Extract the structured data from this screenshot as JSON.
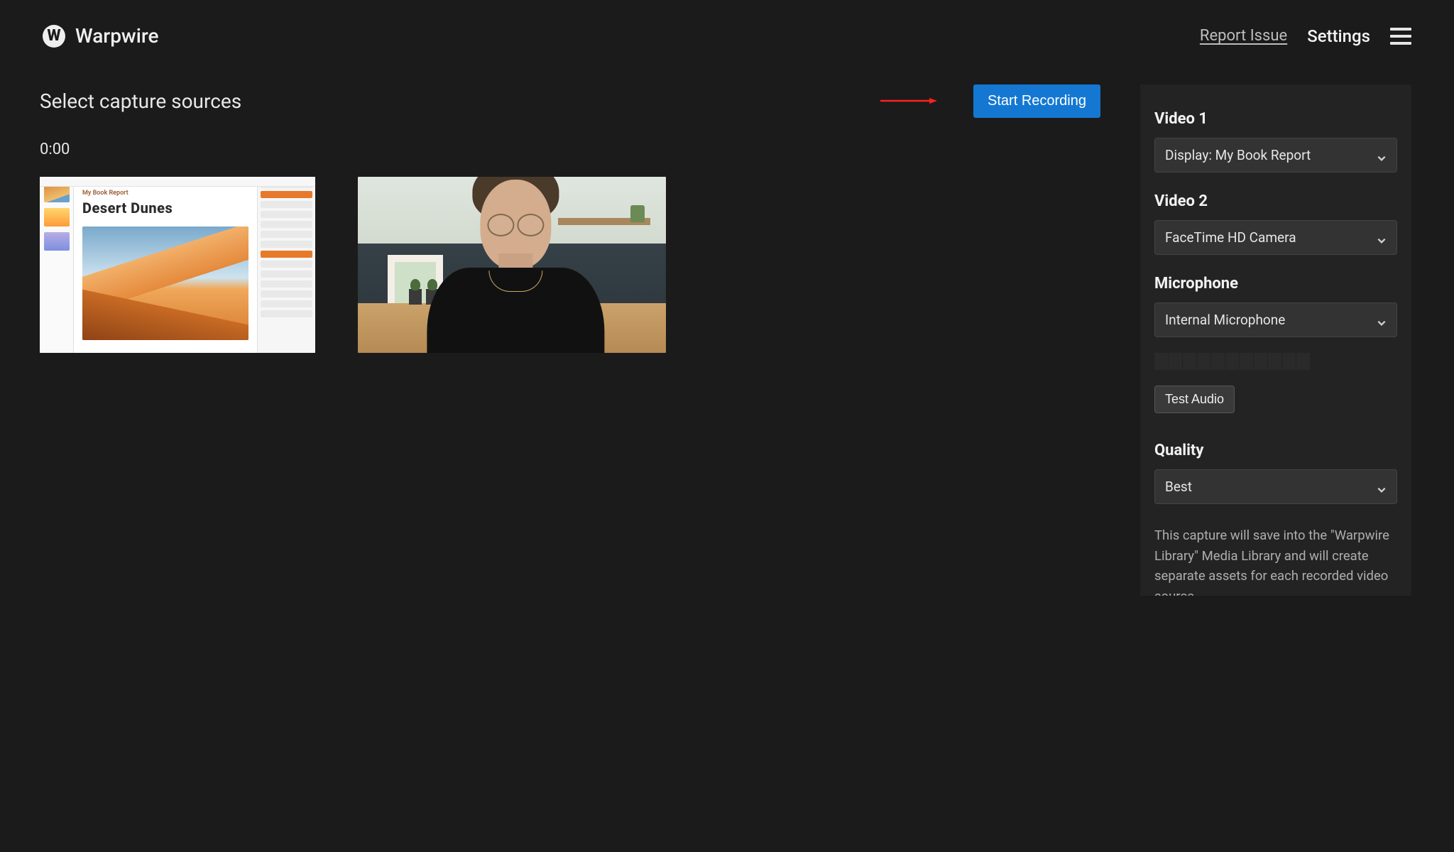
{
  "header": {
    "brand_letter": "W",
    "brand_name": "Warpwire",
    "report_issue": "Report Issue",
    "settings": "Settings"
  },
  "left": {
    "title": "Select capture sources",
    "start_button": "Start Recording",
    "timer": "0:00",
    "screen_preview": {
      "subtitle": "My Book Report",
      "heading": "Desert Dunes"
    }
  },
  "right": {
    "video1": {
      "label": "Video 1",
      "value": "Display: My Book Report"
    },
    "video2": {
      "label": "Video 2",
      "value": "FaceTime HD Camera"
    },
    "mic": {
      "label": "Microphone",
      "value": "Internal Microphone"
    },
    "test_audio": "Test Audio",
    "quality": {
      "label": "Quality",
      "value": "Best"
    },
    "note": "This capture will save into the \"Warpwire Library\" Media Library and will create separate assets for each recorded video source"
  },
  "colors": {
    "primary": "#1478d2",
    "annotation": "#ff1f1f"
  }
}
